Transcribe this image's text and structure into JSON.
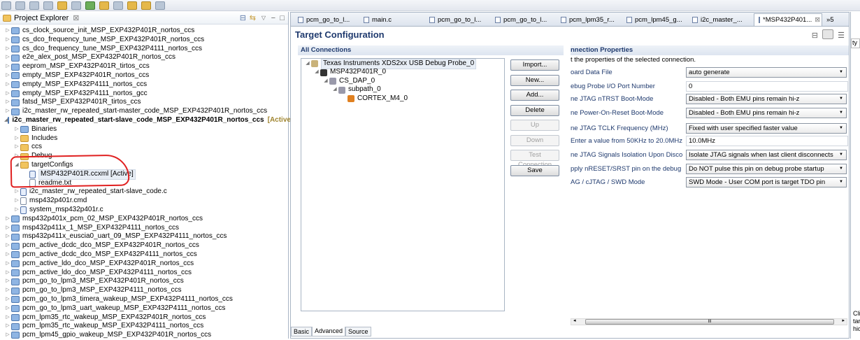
{
  "explorer": {
    "title": "Project Explorer",
    "close": "⊠",
    "items": [
      {
        "label": "cs_clock_source_init_MSP_EXP432P401R_nortos_ccs",
        "depth": 0,
        "icon": "project-icon",
        "tw": "▷"
      },
      {
        "label": "cs_dco_frequency_tune_MSP_EXP432P401R_nortos_ccs",
        "depth": 0,
        "icon": "project-icon",
        "tw": "▷"
      },
      {
        "label": "cs_dco_frequency_tune_MSP_EXP432P4111_nortos_ccs",
        "depth": 0,
        "icon": "project-icon",
        "tw": "▷"
      },
      {
        "label": "e2e_alex_post_MSP_EXP432P401R_nortos_ccs",
        "depth": 0,
        "icon": "project-warning-icon",
        "tw": "▷"
      },
      {
        "label": "eeprom_MSP_EXP432P401R_tirtos_ccs",
        "depth": 0,
        "icon": "project-icon",
        "tw": "▷"
      },
      {
        "label": "empty_MSP_EXP432P401R_nortos_ccs",
        "depth": 0,
        "icon": "project-error-icon",
        "tw": "▷"
      },
      {
        "label": "empty_MSP_EXP432P4111_nortos_ccs",
        "depth": 0,
        "icon": "project-icon",
        "tw": "▷"
      },
      {
        "label": "empty_MSP_EXP432P4111_nortos_gcc",
        "depth": 0,
        "icon": "project-icon",
        "tw": "▷"
      },
      {
        "label": "fatsd_MSP_EXP432P401R_tirtos_ccs",
        "depth": 0,
        "icon": "project-icon",
        "tw": "▷"
      },
      {
        "label": "i2c_master_rw_repeated_start-master_code_MSP_EXP432P401R_nortos_ccs",
        "depth": 0,
        "icon": "project-icon",
        "tw": "▷"
      },
      {
        "label": "i2c_master_rw_repeated_start-slave_code_MSP_EXP432P401R_nortos_ccs",
        "depth": 0,
        "icon": "project-icon",
        "tw": "◢",
        "bold": true,
        "suffix": "[Active - Debug]"
      },
      {
        "label": "Binaries",
        "depth": 1,
        "icon": "binaries-icon",
        "tw": "▷"
      },
      {
        "label": "Includes",
        "depth": 1,
        "icon": "includes-icon",
        "tw": "▷"
      },
      {
        "label": "ccs",
        "depth": 1,
        "icon": "folder-icon",
        "tw": "▷"
      },
      {
        "label": "Debug",
        "depth": 1,
        "icon": "folder-icon",
        "tw": "▷"
      },
      {
        "label": "targetConfigs",
        "depth": 1,
        "icon": "folder-icon",
        "tw": "◢"
      },
      {
        "label": "MSP432P401R.ccxml [Active]",
        "depth": 2,
        "icon": "ccxml-file-icon",
        "tw": "",
        "selected": true
      },
      {
        "label": "readme.txt",
        "depth": 2,
        "icon": "text-file-icon",
        "tw": ""
      },
      {
        "label": "i2c_master_rw_repeated_start-slave_code.c",
        "depth": 1,
        "icon": "c-file-icon",
        "tw": "▷"
      },
      {
        "label": "msp432p401r.cmd",
        "depth": 1,
        "icon": "cmd-file-icon",
        "tw": "▷"
      },
      {
        "label": "system_msp432p401r.c",
        "depth": 1,
        "icon": "c-file-icon",
        "tw": "▷"
      },
      {
        "label": "msp432p401x_pcm_02_MSP_EXP432P401R_nortos_ccs",
        "depth": 0,
        "icon": "project-warning-icon",
        "tw": "▷"
      },
      {
        "label": "msp432p411x_1_MSP_EXP432P4111_nortos_ccs",
        "depth": 0,
        "icon": "project-icon",
        "tw": "▷"
      },
      {
        "label": "msp432p411x_euscia0_uart_09_MSP_EXP432P4111_nortos_ccs",
        "depth": 0,
        "icon": "project-icon",
        "tw": "▷"
      },
      {
        "label": "pcm_active_dcdc_dco_MSP_EXP432P401R_nortos_ccs",
        "depth": 0,
        "icon": "project-icon",
        "tw": "▷"
      },
      {
        "label": "pcm_active_dcdc_dco_MSP_EXP432P4111_nortos_ccs",
        "depth": 0,
        "icon": "project-icon",
        "tw": "▷"
      },
      {
        "label": "pcm_active_ldo_dco_MSP_EXP432P401R_nortos_ccs",
        "depth": 0,
        "icon": "project-icon",
        "tw": "▷"
      },
      {
        "label": "pcm_active_ldo_dco_MSP_EXP432P4111_nortos_ccs",
        "depth": 0,
        "icon": "project-icon",
        "tw": "▷"
      },
      {
        "label": "pcm_go_to_lpm3_MSP_EXP432P401R_nortos_ccs",
        "depth": 0,
        "icon": "project-icon",
        "tw": "▷"
      },
      {
        "label": "pcm_go_to_lpm3_MSP_EXP432P4111_nortos_ccs",
        "depth": 0,
        "icon": "project-icon",
        "tw": "▷"
      },
      {
        "label": "pcm_go_to_lpm3_timera_wakeup_MSP_EXP432P4111_nortos_ccs",
        "depth": 0,
        "icon": "project-icon",
        "tw": "▷"
      },
      {
        "label": "pcm_go_to_lpm3_uart_wakeup_MSP_EXP432P4111_nortos_ccs",
        "depth": 0,
        "icon": "project-icon",
        "tw": "▷"
      },
      {
        "label": "pcm_lpm35_rtc_wakeup_MSP_EXP432P401R_nortos_ccs",
        "depth": 0,
        "icon": "project-icon",
        "tw": "▷"
      },
      {
        "label": "pcm_lpm35_rtc_wakeup_MSP_EXP432P4111_nortos_ccs",
        "depth": 0,
        "icon": "project-icon",
        "tw": "▷"
      },
      {
        "label": "pcm_lpm45_gpio_wakeup_MSP_EXP432P401R_nortos_ccs",
        "depth": 0,
        "icon": "project-icon",
        "tw": "▷"
      }
    ]
  },
  "editor": {
    "tabs": [
      {
        "label": "pcm_go_to_l..."
      },
      {
        "label": "main.c"
      },
      {
        "label": "pcm_go_to_l..."
      },
      {
        "label": "pcm_go_to_l..."
      },
      {
        "label": "pcm_lpm35_r..."
      },
      {
        "label": "pcm_lpm45_g..."
      },
      {
        "label": "i2c_master_..."
      },
      {
        "label": "*MSP432P401...",
        "active": true
      }
    ],
    "overflow": "»5",
    "title": "Target Configuration",
    "all_connections": "All Connections",
    "connections": [
      {
        "label": "Texas Instruments XDS2xx USB Debug Probe_0",
        "depth": 0
      },
      {
        "label": "MSP432P401R_0",
        "depth": 1
      },
      {
        "label": "CS_DAP_0",
        "depth": 2
      },
      {
        "label": "subpath_0",
        "depth": 3
      },
      {
        "label": "CORTEX_M4_0",
        "depth": 4
      }
    ],
    "buttons": [
      {
        "label": "Import...",
        "enabled": true
      },
      {
        "label": "New...",
        "enabled": true
      },
      {
        "label": "Add...",
        "enabled": true
      },
      {
        "label": "Delete",
        "enabled": true
      },
      {
        "label": "Up",
        "enabled": false
      },
      {
        "label": "Down",
        "enabled": false
      },
      {
        "label": "Test Connection",
        "enabled": false
      },
      {
        "label": "Save",
        "enabled": true
      }
    ],
    "props_title": "nnection Properties",
    "props_desc": "t the properties of the selected connection.",
    "props": [
      {
        "label": "oard Data File",
        "value": "auto generate",
        "kind": "select"
      },
      {
        "label": "ebug Probe I/O Port Number",
        "value": "0",
        "kind": "input"
      },
      {
        "label": "ne JTAG nTRST Boot-Mode",
        "value": "Disabled - Both EMU pins remain hi-z",
        "kind": "select"
      },
      {
        "label": "ne Power-On-Reset Boot-Mode",
        "value": "Disabled - Both EMU pins remain hi-z",
        "kind": "select"
      },
      {
        "label": "ne JTAG TCLK Frequency (MHz)",
        "value": "Fixed with user specified faster value",
        "kind": "select"
      },
      {
        "label": " Enter a value from 50KHz to 20.0MHz",
        "value": "10.0MHz",
        "kind": "input"
      },
      {
        "label": "ne JTAG Signals Isolation Upon Disconnect",
        "value": "Isolate JTAG signals when last client disconnects",
        "kind": "select"
      },
      {
        "label": "pply nRESET/SRST pin on the debug header",
        "value": "Do NOT pulse this pin on debug probe startup",
        "kind": "select"
      },
      {
        "label": "AG / cJTAG / SWD Mode",
        "value": "SWD Mode - User COM port is target TDO pin",
        "kind": "select"
      }
    ],
    "scroll_thumb": "III",
    "bottom_tabs": [
      {
        "label": "Basic"
      },
      {
        "label": "Advanced",
        "active": true
      },
      {
        "label": "Source"
      }
    ]
  },
  "right_panel": {
    "search": "ty",
    "hint_lines": [
      "Cli",
      "tar",
      "hid"
    ]
  }
}
